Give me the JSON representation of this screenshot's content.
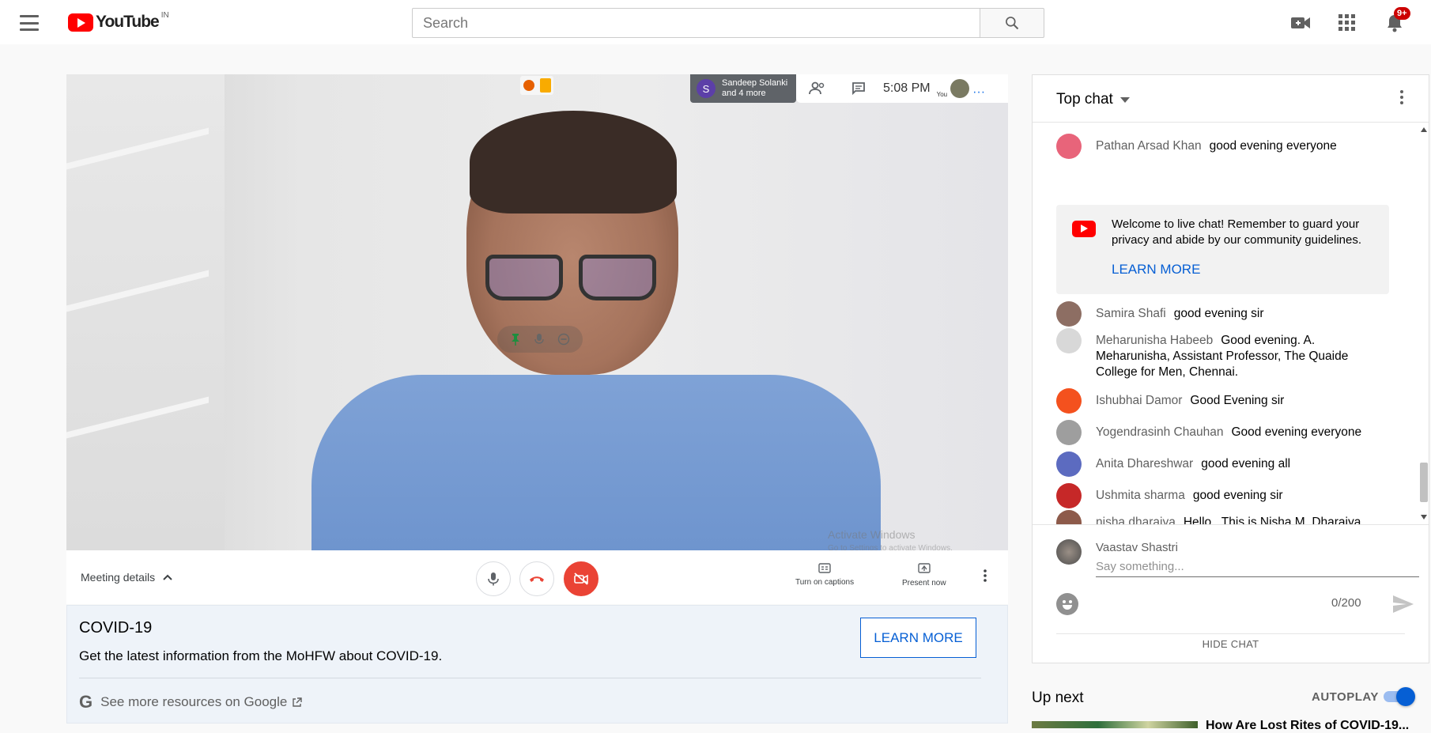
{
  "header": {
    "logo_text": "YouTube",
    "country_code": "IN",
    "search_placeholder": "Search",
    "notification_count": "9+"
  },
  "meet": {
    "participants_initial": "S",
    "participants_line1": "Sandeep Solanki",
    "participants_line2": "and 4 more",
    "time": "5:08  PM",
    "you_label": "You",
    "meeting_details": "Meeting details",
    "captions_label": "Turn on captions",
    "present_label": "Present now",
    "activate_title": "Activate Windows",
    "activate_sub": "Go to Settings to activate Windows."
  },
  "covid": {
    "title": "COVID-19",
    "description": "Get the latest information from the MoHFW about COVID-19.",
    "learn_more": "LEARN MORE",
    "more_resources": "See more resources on Google"
  },
  "chat": {
    "header": "Top chat",
    "messages": [
      {
        "author": "Pathan Arsad Khan",
        "text": "good evening everyone",
        "avatar_color": "#e8647a"
      },
      {
        "author": "Samira Shafi",
        "text": "good evening sir",
        "avatar_color": "#8d6e63"
      },
      {
        "author": "Meharunisha Habeeb",
        "text": "Good evening. A. Meharunisha, Assistant Professor, The Quaide College for Men, Chennai.",
        "avatar_color": "#d8d8d8"
      },
      {
        "author": "Ishubhai Damor",
        "text": "Good Evening sir",
        "avatar_color": "#f4511e"
      },
      {
        "author": "Yogendrasinh Chauhan",
        "text": "Good evening everyone",
        "avatar_color": "#9e9e9e"
      },
      {
        "author": "Anita Dhareshwar",
        "text": "good evening all",
        "avatar_color": "#5c6bc0"
      },
      {
        "author": "Ushmita sharma",
        "text": "good evening sir",
        "avatar_color": "#c62828"
      },
      {
        "author": "nisha dharaiya",
        "text": "Hello , This is Nisha M. Dharaiya from shree Swaminarayan Arts College, Ahmedabad",
        "avatar_color": "#8d5a4a"
      }
    ],
    "welcome_text": "Welcome to live chat! Remember to guard your privacy and abide by our community guidelines.",
    "welcome_learn": "LEARN MORE",
    "self_name": "Vaastav Shastri",
    "input_placeholder": "Say something...",
    "char_count": "0/200",
    "hide_chat": "HIDE CHAT"
  },
  "up_next": {
    "label": "Up next",
    "autoplay": "AUTOPLAY",
    "autoplay_on": true,
    "next_title": "How Are Lost Rites of COVID-19..."
  },
  "colors": {
    "brand_red": "#ff0000",
    "link_blue": "#065fd4",
    "meet_red": "#ea4335"
  }
}
